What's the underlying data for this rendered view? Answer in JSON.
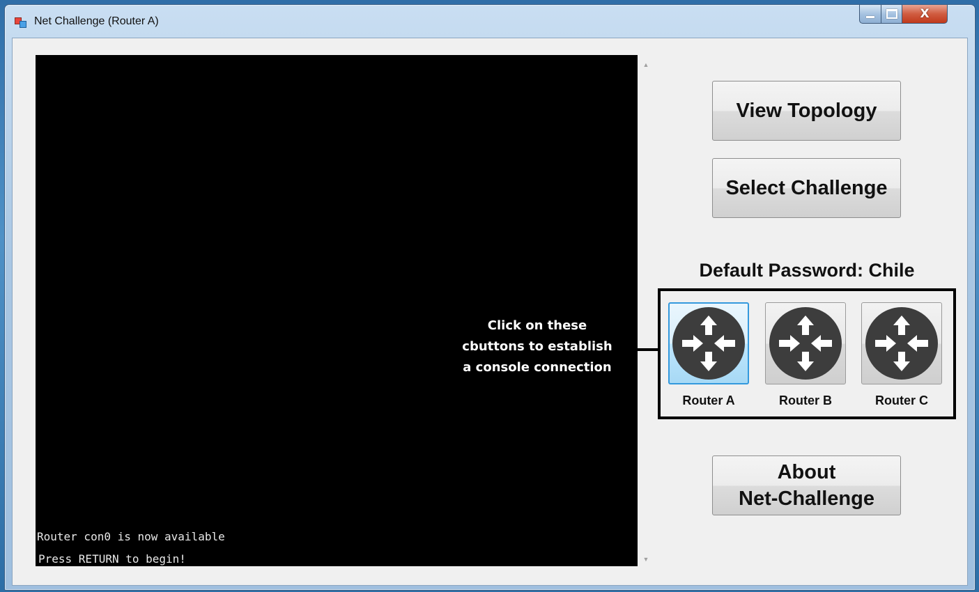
{
  "window": {
    "title": "Net Challenge (Router A)",
    "caption": {
      "close_glyph": "X"
    }
  },
  "console": {
    "lines": [
      "Router con0 is now available",
      "Press RETURN to begin!"
    ],
    "annotation": [
      "Click on these",
      "cbuttons to establish",
      "a console connection"
    ],
    "background": "#000000",
    "text_color": "#e8e8e8"
  },
  "buttons": {
    "view_topology": "View Topology",
    "select_challenge": "Select Challenge",
    "about_line1": "About",
    "about_line2": "Net-Challenge"
  },
  "password": {
    "label": "Default Password: Chile"
  },
  "routers": [
    {
      "label": "Router A",
      "icon": "router-icon",
      "active": true
    },
    {
      "label": "Router B",
      "icon": "router-icon",
      "active": false
    },
    {
      "label": "Router C",
      "icon": "router-icon",
      "active": false
    }
  ],
  "colors": {
    "active_accent": "#3399dd",
    "title_bar": "#a8c6e3",
    "close_button": "#c0391c"
  }
}
